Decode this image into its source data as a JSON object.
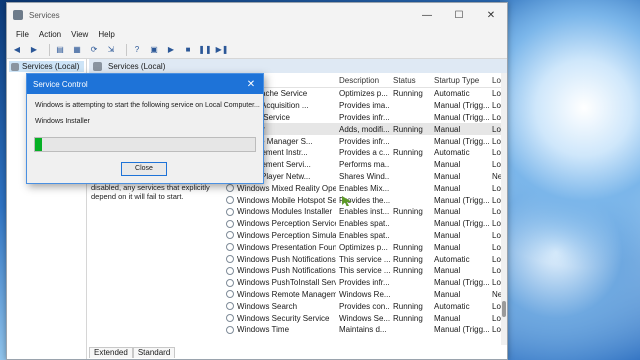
{
  "window": {
    "title": "Services",
    "controls": [
      "—",
      "☐",
      "✕"
    ]
  },
  "menu": [
    "File",
    "Action",
    "View",
    "Help"
  ],
  "tree": {
    "item": "Services (Local)"
  },
  "pane": {
    "title": "Services (Local)"
  },
  "description": {
    "text": "disabled, any services that explicitly depend on it will fail to start."
  },
  "table": {
    "columns": [
      "Description",
      "Status",
      "Startup Type",
      "Lo"
    ],
    "rows": [
      {
        "name": "Font Cache Service",
        "desc": "Optimizes p...",
        "status": "Running",
        "startup": "Automatic",
        "log": "Loc"
      },
      {
        "name": "Image Acquisition ...",
        "desc": "Provides ima...",
        "status": "",
        "startup": "Manual (Trigg...",
        "log": "Loc"
      },
      {
        "name": "Insider Service",
        "desc": "Provides infr...",
        "status": "",
        "startup": "Manual (Trigg...",
        "log": "Loc"
      },
      {
        "name": "Installer",
        "desc": "Adds, modifi...",
        "status": "Running",
        "startup": "Manual",
        "log": "Loc"
      },
      {
        "name": "License Manager S...",
        "desc": "Provides infr...",
        "status": "",
        "startup": "Manual (Trigg...",
        "log": "Loc"
      },
      {
        "name": "Management Instr...",
        "desc": "Provides a c...",
        "status": "Running",
        "startup": "Automatic",
        "log": "Loc"
      },
      {
        "name": "Management Servi...",
        "desc": "Performs ma...",
        "status": "",
        "startup": "Manual",
        "log": "Loc"
      },
      {
        "name": "Media Player Netw...",
        "desc": "Shares Wind...",
        "status": "",
        "startup": "Manual",
        "log": "Ne"
      },
      {
        "name": "Windows Mixed Reality Ope...",
        "desc": "Enables Mix...",
        "status": "",
        "startup": "Manual",
        "log": "Loc"
      },
      {
        "name": "Windows Mobile Hotspot Se...",
        "desc": "Provides the...",
        "status": "",
        "startup": "Manual (Trigg...",
        "log": "Loc"
      },
      {
        "name": "Windows Modules Installer",
        "desc": "Enables inst...",
        "status": "Running",
        "startup": "Manual",
        "log": "Loc"
      },
      {
        "name": "Windows Perception Service",
        "desc": "Enables spat...",
        "status": "",
        "startup": "Manual (Trigg...",
        "log": "Loc"
      },
      {
        "name": "Windows Perception Simulat...",
        "desc": "Enables spat...",
        "status": "",
        "startup": "Manual",
        "log": "Loc"
      },
      {
        "name": "Windows Presentation Foun...",
        "desc": "Optimizes p...",
        "status": "Running",
        "startup": "Manual",
        "log": "Loc"
      },
      {
        "name": "Windows Push Notifications...",
        "desc": "This service ...",
        "status": "Running",
        "startup": "Automatic",
        "log": "Loc"
      },
      {
        "name": "Windows Push Notifications...",
        "desc": "This service ...",
        "status": "Running",
        "startup": "Manual",
        "log": "Loc"
      },
      {
        "name": "Windows PushToInstall Servi...",
        "desc": "Provides infr...",
        "status": "",
        "startup": "Manual (Trigg...",
        "log": "Loc"
      },
      {
        "name": "Windows Remote Manageme...",
        "desc": "Windows Re...",
        "status": "",
        "startup": "Manual",
        "log": "Ne"
      },
      {
        "name": "Windows Search",
        "desc": "Provides con...",
        "status": "Running",
        "startup": "Automatic",
        "log": "Loc"
      },
      {
        "name": "Windows Security Service",
        "desc": "Windows Se...",
        "status": "Running",
        "startup": "Manual",
        "log": "Loc"
      },
      {
        "name": "Windows Time",
        "desc": "Maintains d...",
        "status": "",
        "startup": "Manual (Trigg...",
        "log": "Loc"
      }
    ]
  },
  "tabs": [
    "Extended",
    "Standard"
  ],
  "dialog": {
    "title": "Service Control",
    "message": "Windows is attempting to start the following service on Local Computer...",
    "service": "Windows Installer",
    "progress": 0.03,
    "close_label": "Close"
  },
  "colors": {
    "accent": "#1e73d8",
    "progress": "#06b025"
  }
}
